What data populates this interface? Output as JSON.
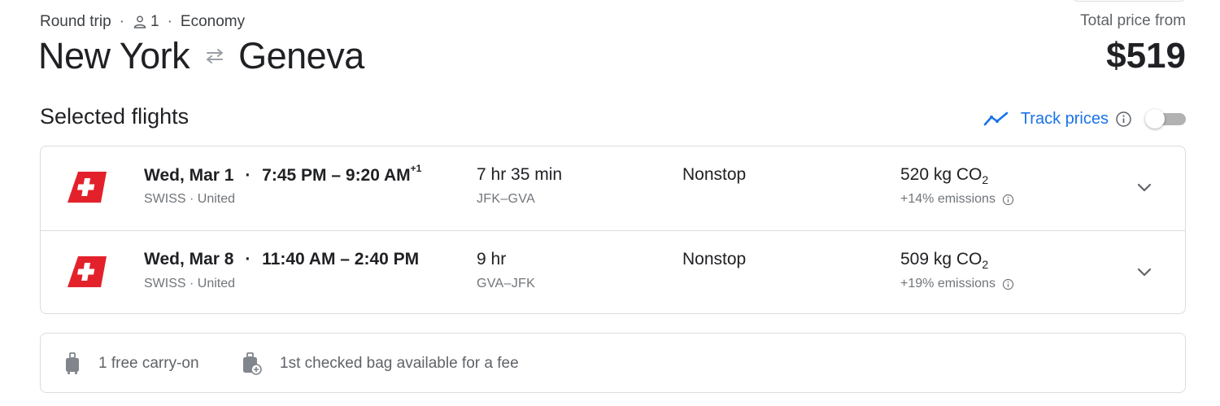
{
  "trip": {
    "type": "Round trip",
    "passengers": "1",
    "cabin": "Economy",
    "separator": "·",
    "origin": "New York",
    "destination": "Geneva"
  },
  "price": {
    "label": "Total price from",
    "value": "$519"
  },
  "section_title": "Selected flights",
  "track_prices": {
    "label": "Track prices",
    "enabled": false
  },
  "flights": [
    {
      "date": "Wed, Mar 1",
      "times": "7:45 PM – 9:20 AM",
      "day_offset": "+1",
      "airlines": "SWISS · United",
      "duration": "7 hr 35 min",
      "airports": "JFK–GVA",
      "stops": "Nonstop",
      "emissions_value": "520 kg CO",
      "emissions_sub": "2",
      "emissions_pct": "+14% emissions"
    },
    {
      "date": "Wed, Mar 8",
      "times": "11:40 AM – 2:40 PM",
      "day_offset": "",
      "airlines": "SWISS · United",
      "duration": "9 hr",
      "airports": "GVA–JFK",
      "stops": "Nonstop",
      "emissions_value": "509 kg CO",
      "emissions_sub": "2",
      "emissions_pct": "+19% emissions"
    }
  ],
  "baggage": {
    "carry_on": "1 free carry-on",
    "checked": "1st checked bag available for a fee"
  },
  "colors": {
    "accent": "#1a73e8",
    "swiss_red": "#e3212b",
    "border": "#dadce0",
    "text": "#202124",
    "secondary": "#70757a"
  },
  "icons": [
    "person-icon",
    "swap-arrows-icon",
    "trend-icon",
    "info-icon",
    "swiss-logo",
    "chevron-down-icon",
    "carry-on-bag-icon",
    "checked-bag-icon"
  ]
}
